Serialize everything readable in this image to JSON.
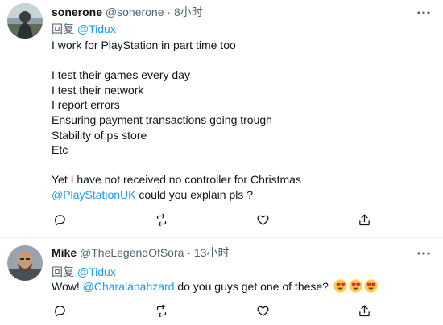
{
  "tweets": [
    {
      "author_name": "sonerone",
      "handle": "@sonerone",
      "separator": "·",
      "time": "8小时",
      "reply_prefix": "回复",
      "reply_to": "@Tidux",
      "lines": [
        "I work for PlayStation in part time too",
        "",
        "I test their games every day",
        "I test their network",
        "I report errors",
        "Ensuring payment transactions going trough",
        "Stability of ps store",
        "Etc",
        "",
        "Yet I have not received no controller for Christmas"
      ],
      "last_line_mention": "@PlayStationUK",
      "last_line_rest": " could you explain pls ?"
    },
    {
      "author_name": "Mike",
      "handle": "@TheLegendOfSora",
      "separator": "·",
      "time": "13小时",
      "reply_prefix": "回复",
      "reply_to": "@Tidux",
      "text_before": "Wow! ",
      "mention": "@Charalanahzard",
      "text_after": " do you guys get one of these? ",
      "emojis": [
        "heart-eyes-emoji",
        "heart-eyes-emoji",
        "heart-eyes-emoji"
      ]
    }
  ],
  "colors": {
    "text_primary": "#0f1419",
    "text_secondary": "#536471",
    "link": "#1d9bf0",
    "divider": "#eff3f4"
  },
  "icons": [
    "reply-icon",
    "retweet-icon",
    "like-icon",
    "share-icon",
    "more-icon"
  ]
}
